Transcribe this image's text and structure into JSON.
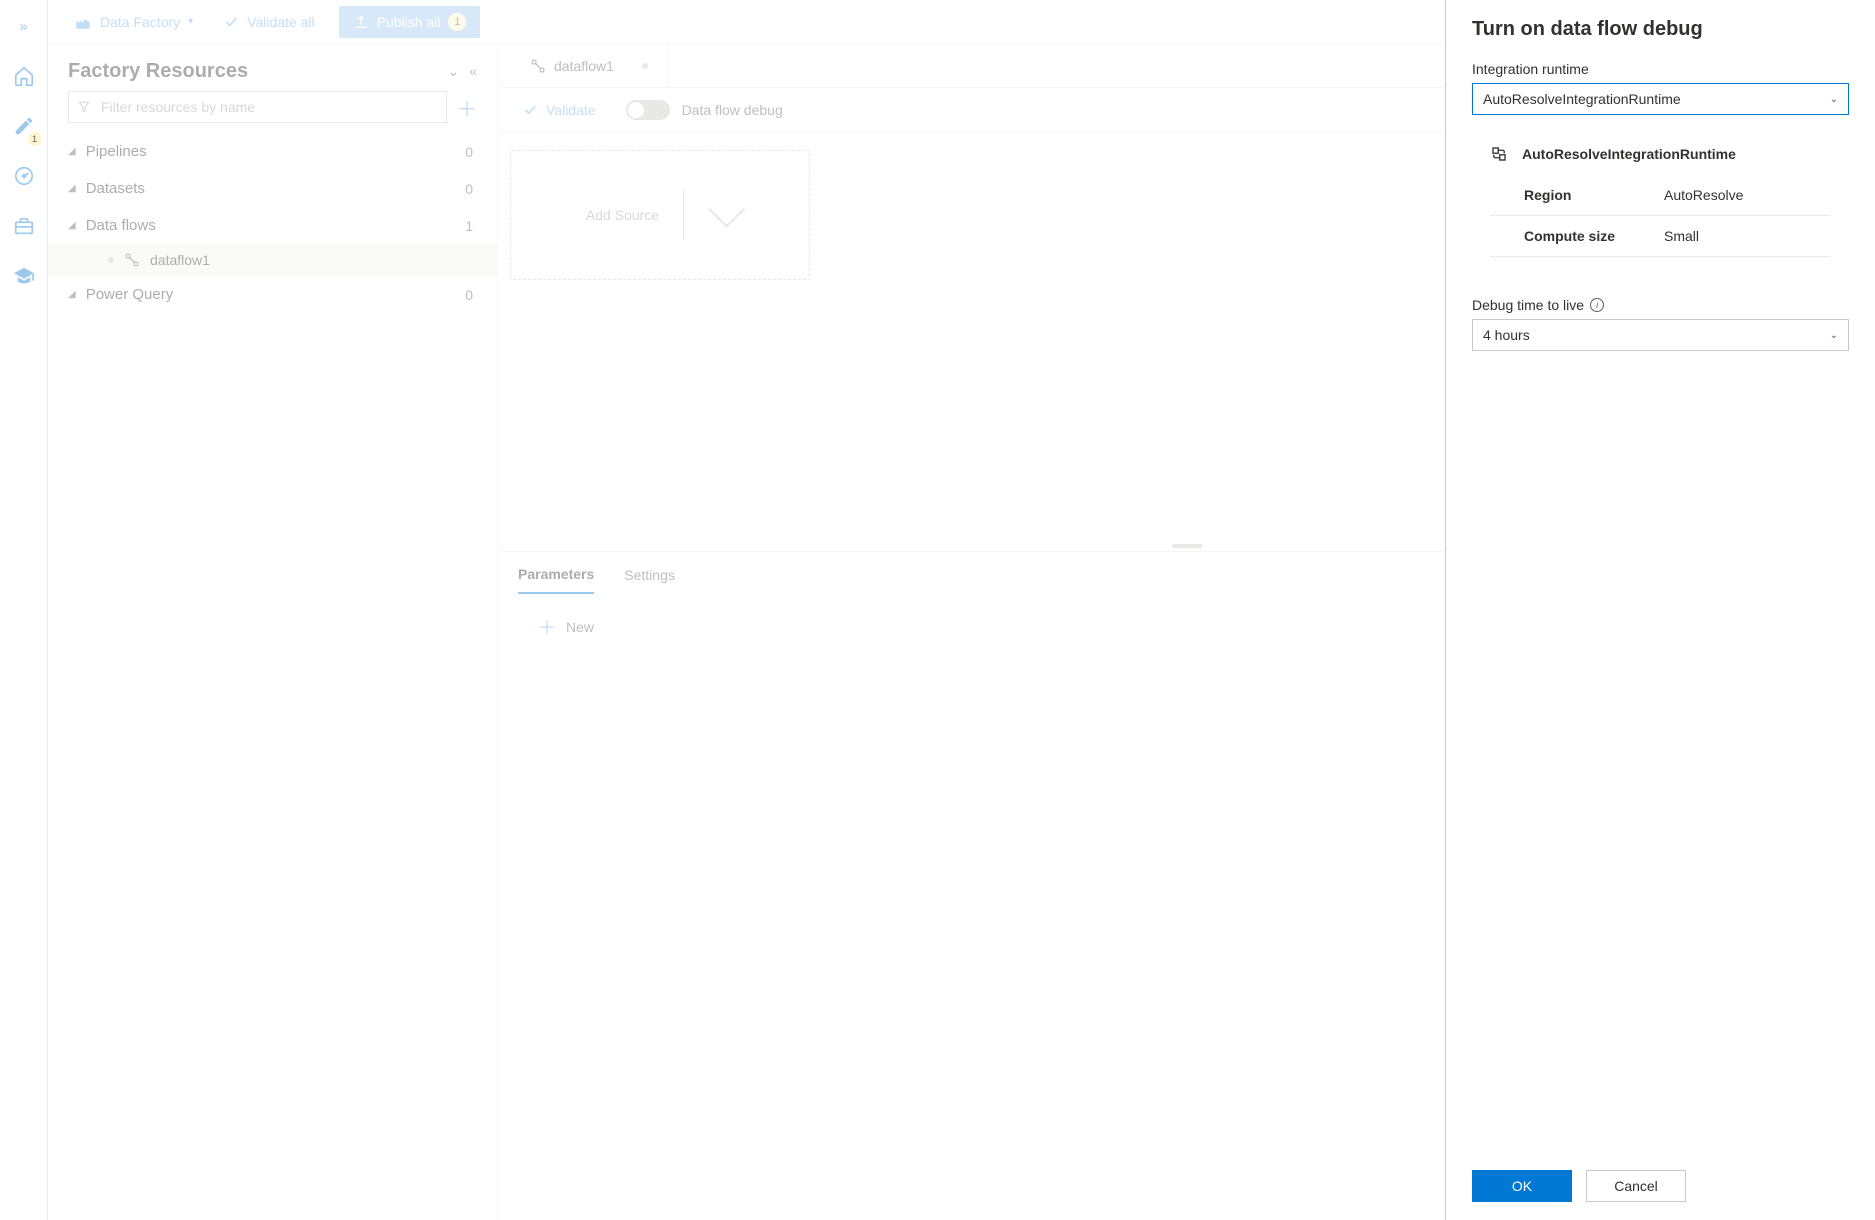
{
  "leftRail": {
    "authorBadge": "1"
  },
  "toolbar": {
    "dataFactoryLabel": "Data Factory",
    "validateAllLabel": "Validate all",
    "publishAllLabel": "Publish all",
    "publishCount": "1"
  },
  "resources": {
    "title": "Factory Resources",
    "filterPlaceholder": "Filter resources by name",
    "groups": [
      {
        "label": "Pipelines",
        "count": "0"
      },
      {
        "label": "Datasets",
        "count": "0"
      },
      {
        "label": "Data flows",
        "count": "1"
      },
      {
        "label": "Power Query",
        "count": "0"
      }
    ],
    "dataflowItem": "dataflow1"
  },
  "editor": {
    "tabName": "dataflow1",
    "validateLabel": "Validate",
    "debugToggleLabel": "Data flow debug",
    "addSourceLabel": "Add Source",
    "bottomTabs": {
      "parameters": "Parameters",
      "settings": "Settings"
    },
    "newLabel": "New"
  },
  "panel": {
    "title": "Turn on data flow debug",
    "irLabel": "Integration runtime",
    "irValue": "AutoResolveIntegrationRuntime",
    "irDetailName": "AutoResolveIntegrationRuntime",
    "regionLabel": "Region",
    "regionValue": "AutoResolve",
    "computeLabel": "Compute size",
    "computeValue": "Small",
    "ttlLabel": "Debug time to live",
    "ttlValue": "4 hours",
    "okLabel": "OK",
    "cancelLabel": "Cancel"
  }
}
